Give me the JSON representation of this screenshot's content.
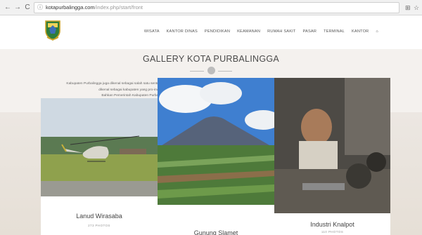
{
  "browser": {
    "url_domain": "kotapurbalingga.com",
    "url_path": "/index.php/start/front"
  },
  "site": {
    "menu": [
      "WISATA",
      "KANTOR DINAS",
      "PENDIDIKAN",
      "KEAMANAN",
      "RUMAH SAKIT",
      "PASAR",
      "TERMINAL",
      "KANTOR"
    ]
  },
  "hero": {
    "title": "GALLERY KOTA PURBALINGGA",
    "description": [
      "Kabupaten Purbalingga juga dikenal sebagai salah satu sentra penghasil sayuran tanaman cabai serta buah stroberi yang berlokasi di lereng Gunung Slamet sebelah tenggara. Purbalingga juga",
      "dikenal sebagai kabupaten yang pro-investasi. Hal ini terlihat dari banyaknya industri kecil hingga besar yang tumbuh dan berkembang di Purbalingga.",
      "Bahkan Pemerintah Kabupaten Purbalingga berencana mengembangkan Pangkalan Udara (Lanud) Wirasaba menjadi sebuah bandara komersial."
    ]
  },
  "gallery": [
    {
      "title": "Lanud Wirasaba",
      "count": "273 PHOTOS"
    },
    {
      "title": "Gunung Slamet",
      "count": ""
    },
    {
      "title": "Industri Knalpot",
      "count": "110 PHOTOS"
    }
  ],
  "icons": {
    "back": "arrow-left-icon",
    "forward": "arrow-right-icon",
    "reload": "reload-icon",
    "info": "info-icon",
    "translate": "translate-icon",
    "star": "star-icon",
    "home": "home-icon",
    "logo": "coat-of-arms-logo"
  },
  "colors": {
    "hero_bg": "#f4f1ee",
    "title": "#4a4a4a",
    "menu": "#555555"
  }
}
